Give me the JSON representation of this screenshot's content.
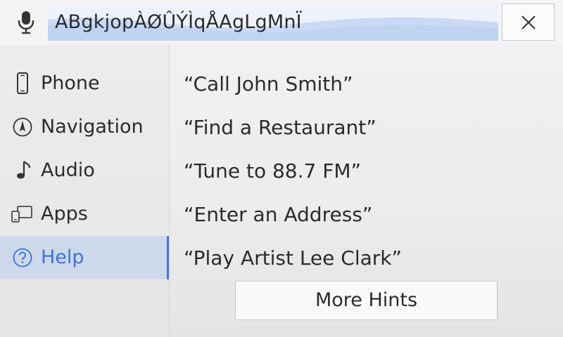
{
  "voice_input": {
    "transcript": "ABgkjopÀØÛÝÌqÅAgLgMnÏ",
    "mic_icon": "microphone-icon",
    "close_icon": "close-icon"
  },
  "sidebar": {
    "items": [
      {
        "label": "Phone",
        "icon": "phone-icon",
        "active": false
      },
      {
        "label": "Navigation",
        "icon": "compass-icon",
        "active": false
      },
      {
        "label": "Audio",
        "icon": "music-note-icon",
        "active": false
      },
      {
        "label": "Apps",
        "icon": "apps-icon",
        "active": false
      },
      {
        "label": "Help",
        "icon": "help-icon",
        "active": true
      }
    ]
  },
  "hints": {
    "items": [
      "“Call John Smith”",
      "“Find a Restaurant”",
      "“Tune to 88.7 FM”",
      "“Enter an Address”",
      "“Play Artist Lee Clark”"
    ],
    "more_label": "More Hints"
  },
  "colors": {
    "accent": "#3a74e0",
    "active_bg": "#cdd8ea",
    "wave": "#c9daf6"
  }
}
